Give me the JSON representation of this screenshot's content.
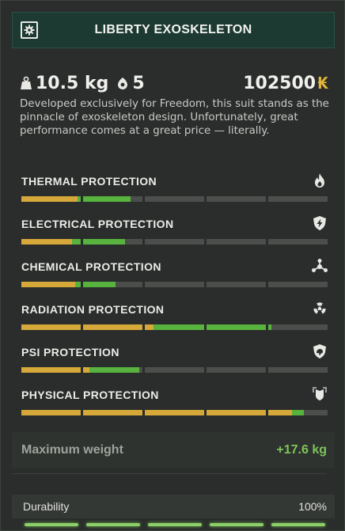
{
  "header": {
    "title": "LIBERTY EXOSKELETON",
    "settings_icon": "gear-icon"
  },
  "stats": {
    "weight": "10.5 kg",
    "slots": "5",
    "price": "102500",
    "currency_symbol": "₭"
  },
  "description": "Developed exclusively for Freedom, this suit stands as the pinnacle of exoskeleton design. Unfortunately, great performance comes at a great price — literally.",
  "protections": [
    {
      "label": "THERMAL PROTECTION",
      "icon": "flame-icon",
      "base": 0.19,
      "bonus": 0.17
    },
    {
      "label": "ELECTRICAL PROTECTION",
      "icon": "lightning-shield-icon",
      "base": 0.17,
      "bonus": 0.17
    },
    {
      "label": "CHEMICAL PROTECTION",
      "icon": "molecule-icon",
      "base": 0.18,
      "bonus": 0.13
    },
    {
      "label": "RADIATION PROTECTION",
      "icon": "radiation-icon",
      "base": 0.43,
      "bonus": 0.38
    },
    {
      "label": "PSI PROTECTION",
      "icon": "psi-shield-icon",
      "base": 0.22,
      "bonus": 0.17
    },
    {
      "label": "PHYSICAL PROTECTION",
      "icon": "armor-icon",
      "base": 0.88,
      "bonus": 0.04
    }
  ],
  "max_weight": {
    "label": "Maximum weight",
    "value": "+17.6 kg"
  },
  "durability": {
    "label": "Durability",
    "value": "100%",
    "level": 1.0
  },
  "colors": {
    "base_fill": "#d6a83a",
    "bonus_fill": "#57b33d",
    "empty": "#4b4e4b",
    "accent_green": "#7ec45a",
    "header_bg": "#1c3a32"
  }
}
